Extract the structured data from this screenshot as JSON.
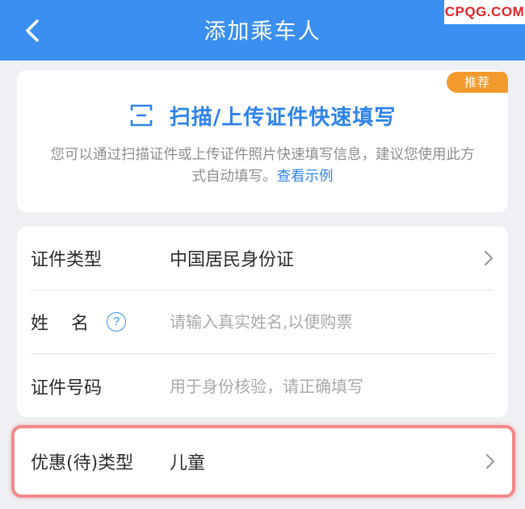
{
  "header": {
    "title": "添加乘车人",
    "watermark": "CPQG.COM",
    "bg_color": "#3b8ff0"
  },
  "scan_card": {
    "badge": "推荐",
    "title": "扫描/上传证件快速填写",
    "description": "您可以通过扫描证件或上传证件照片快速填写信息，建议您使用此方式自动填写。",
    "link": "查看示例",
    "accent_color": "#2f83e8",
    "badge_color": "#f39a2d"
  },
  "form": {
    "id_type": {
      "label": "证件类型",
      "value": "中国居民身份证"
    },
    "name": {
      "label": "姓名",
      "placeholder": "请输入真实姓名,以便购票"
    },
    "id_number": {
      "label": "证件号码",
      "placeholder": "用于身份核验，请正确填写"
    }
  },
  "discount": {
    "label": "优惠(待)类型",
    "value": "儿童",
    "highlight_color": "#f28a8a"
  }
}
